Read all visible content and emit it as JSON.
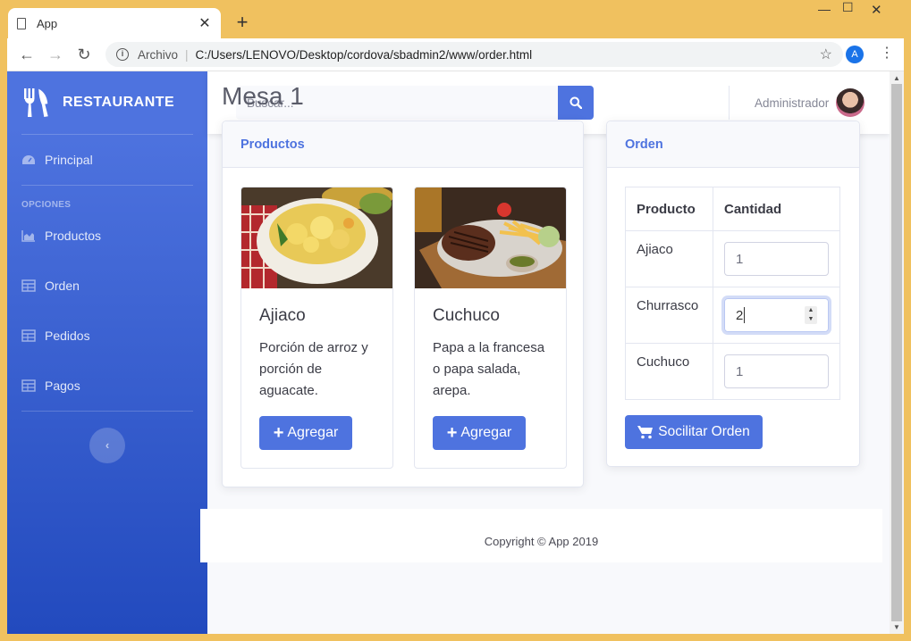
{
  "browser": {
    "tab_title": "App",
    "new_tab": "+",
    "close_tab": "✕",
    "scheme_label": "Archivo",
    "url": "C:/Users/LENOVO/Desktop/cordova/sbadmin2/www/order.html",
    "profile_initial": "A"
  },
  "sidebar": {
    "brand": "RESTAURANTE",
    "items": [
      {
        "label": "Principal",
        "icon": "tachometer-icon"
      },
      {
        "label": "Productos",
        "icon": "chart-area-icon"
      },
      {
        "label": "Orden",
        "icon": "table-icon"
      },
      {
        "label": "Pedidos",
        "icon": "table-icon"
      },
      {
        "label": "Pagos",
        "icon": "table-icon"
      }
    ],
    "heading": "OPCIONES",
    "toggle": "‹"
  },
  "topbar": {
    "search_placeholder": "Buscar...",
    "user_name": "Administrador"
  },
  "page": {
    "title": "Mesa 1"
  },
  "products": {
    "header": "Productos",
    "items": [
      {
        "name": "Ajiaco",
        "description": "Porción de arroz y porción de aguacate.",
        "button": "Agregar"
      },
      {
        "name": "Cuchuco",
        "description": "Papa a la francesa o papa salada, arepa.",
        "button": "Agregar"
      }
    ]
  },
  "order": {
    "header": "Orden",
    "columns": [
      "Producto",
      "Cantidad"
    ],
    "rows": [
      {
        "product": "Ajiaco",
        "quantity": "1"
      },
      {
        "product": "Churrasco",
        "quantity": "2"
      },
      {
        "product": "Cuchuco",
        "quantity": "1"
      }
    ],
    "submit": "Socilitar Orden"
  },
  "footer": {
    "text": "Copyright © App 2019"
  },
  "colors": {
    "primary": "#4e73df",
    "sidebar_bottom": "#224abe",
    "window_frame": "#f0c15f"
  }
}
